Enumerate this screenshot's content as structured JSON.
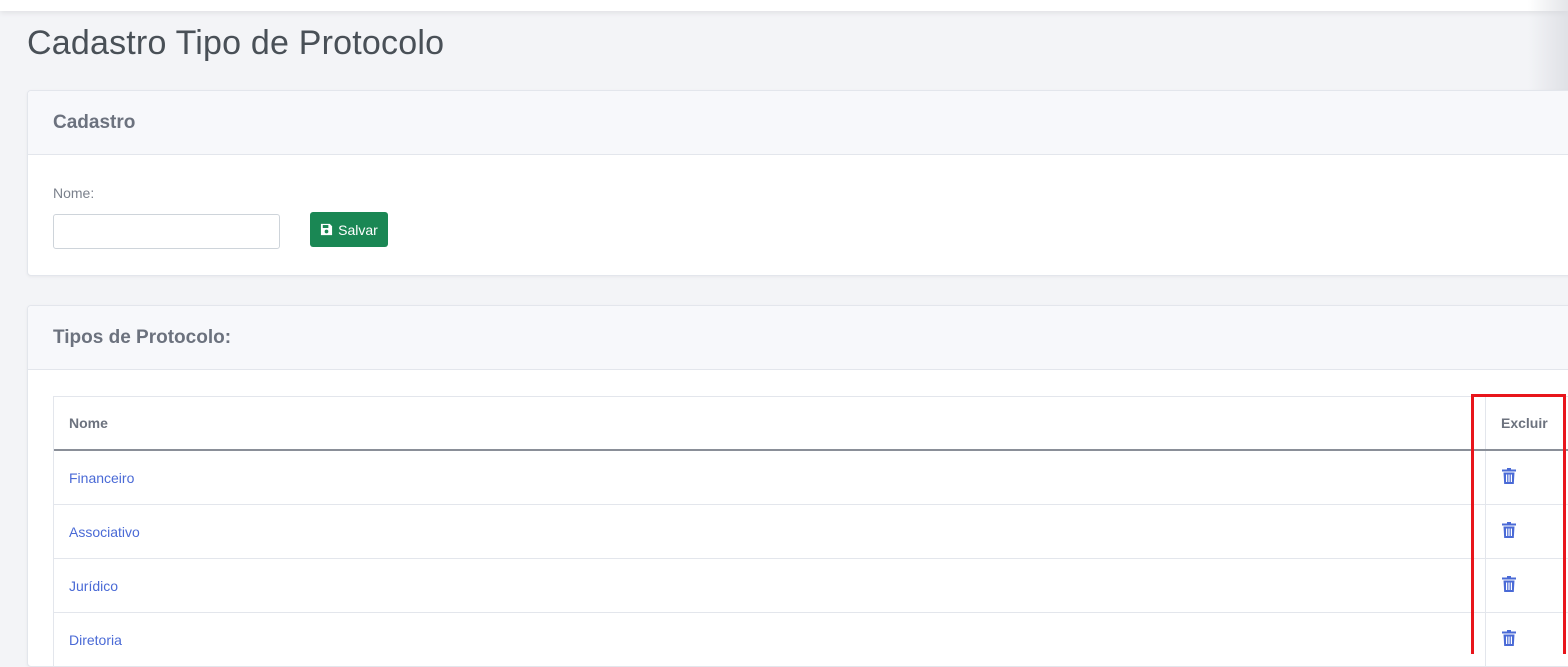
{
  "page": {
    "title": "Cadastro Tipo de Protocolo"
  },
  "cadastro": {
    "header": "Cadastro",
    "name_label": "Nome:",
    "name_value": "",
    "name_placeholder": "",
    "save_label": "Salvar",
    "save_icon": "floppy-disk-icon"
  },
  "tipos": {
    "header": "Tipos de Protocolo:",
    "columns": [
      "Nome",
      "Excluir"
    ],
    "rows": [
      {
        "nome": "Financeiro"
      },
      {
        "nome": "Associativo"
      },
      {
        "nome": "Jurídico"
      },
      {
        "nome": "Diretoria"
      }
    ],
    "delete_icon": "trash-icon"
  },
  "colors": {
    "save_button": "#1a8754",
    "link": "#4a6ad6",
    "highlight": "#e8151b"
  }
}
